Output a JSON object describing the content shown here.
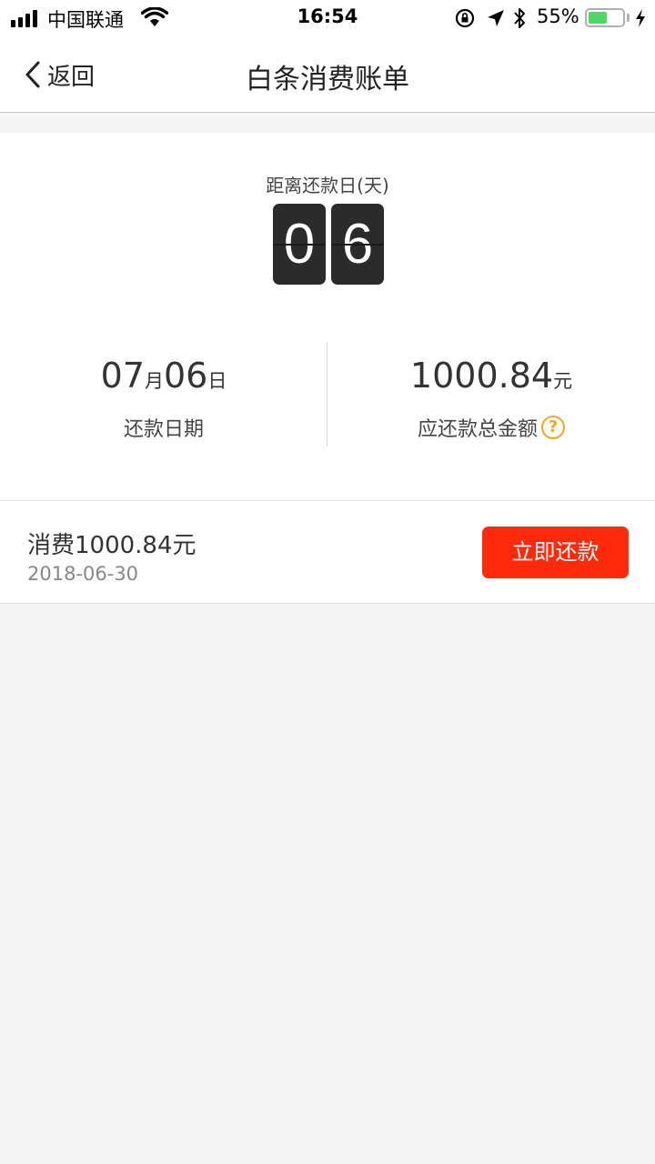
{
  "status_bar": {
    "carrier": "中国联通",
    "time": "16:54",
    "battery_percent": "55%",
    "battery_level": 0.55,
    "battery_color": "#4cd964"
  },
  "navbar": {
    "back_label": "返回",
    "title": "白条消费账单"
  },
  "summary": {
    "countdown_caption": "距离还款日(天)",
    "countdown_digits": [
      "0",
      "6"
    ],
    "due_month": "07",
    "month_unit": "月",
    "due_day": "06",
    "day_unit": "日",
    "due_date_label": "还款日期",
    "total_amount": "1000.84",
    "amount_unit": "元",
    "total_label": "应还款总金额",
    "help_icon": "?"
  },
  "record": {
    "title": "消费1000.84元",
    "date": "2018-06-30",
    "pay_button": "立即还款",
    "pay_button_color": "#ff2a0c"
  }
}
